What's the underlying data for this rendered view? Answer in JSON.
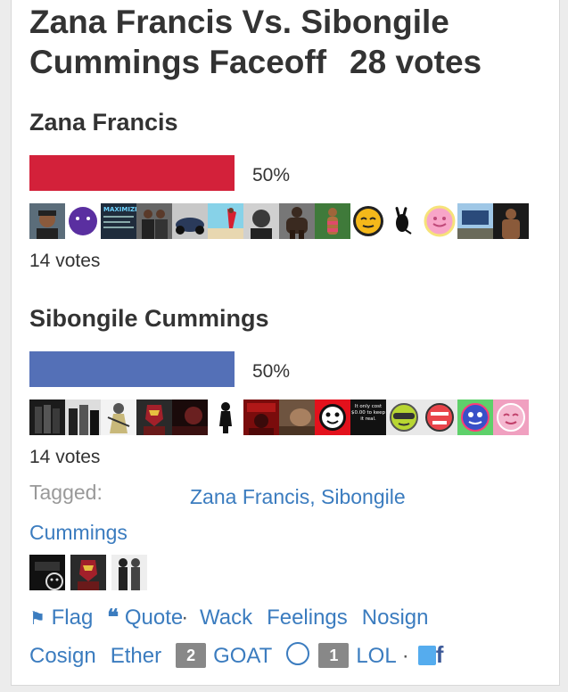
{
  "poll": {
    "title_line": "Zana Francis Vs. Sibongile Cummings Faceoff",
    "total_votes": "28 votes"
  },
  "candidates": [
    {
      "name": "Zana Francis",
      "percent": "50%",
      "percent_value": 50,
      "votes": "14 votes",
      "bar_color": "#d3213a",
      "voter_avatars": [
        "man-selfie",
        "purple-emoji",
        "maximize-poster",
        "couple-photo",
        "motorcycle",
        "beach-woman",
        "man-portrait",
        "bodybuilder",
        "bikini-woman",
        "sleepy-emoji",
        "playboy-bunny",
        "pink-smiley",
        "billboard-sign",
        "shirtless-man"
      ]
    },
    {
      "name": "Sibongile Cummings",
      "percent": "50%",
      "percent_value": 50,
      "votes": "14 votes",
      "bar_color": "#5470b7",
      "voter_avatars": [
        "bottles",
        "bw-group",
        "mannequin",
        "iron-man",
        "dark-photo",
        "silhouette-figure",
        "red-concert",
        "sepia-photo",
        "red-smiley",
        "it-only-cost-text",
        "green-emoji",
        "red-emoji",
        "blue-emoji",
        "pink-emoji"
      ]
    }
  ],
  "tagged_label": "Tagged:",
  "tags": [
    "Zana Francis",
    "Sibongile Cummings"
  ],
  "attached_thumbs": [
    "album-cover",
    "iron-man-thumb",
    "bw-couple-thumb"
  ],
  "actions": {
    "flag": "Flag",
    "quote": "Quote",
    "wack": "Wack",
    "feelings": "Feelings",
    "nosign": "Nosign",
    "cosign": "Cosign",
    "ether": "Ether",
    "goat_count": "2",
    "goat": "GOAT",
    "lol_count": "1",
    "lol": "LOL"
  },
  "avatar_texts": {
    "maximize": "MAXIMIZE",
    "cost": "It only cost $0.00 to keep it real."
  },
  "colors": {
    "link": "#3b7cbf",
    "text": "#333333",
    "muted": "#999999"
  }
}
